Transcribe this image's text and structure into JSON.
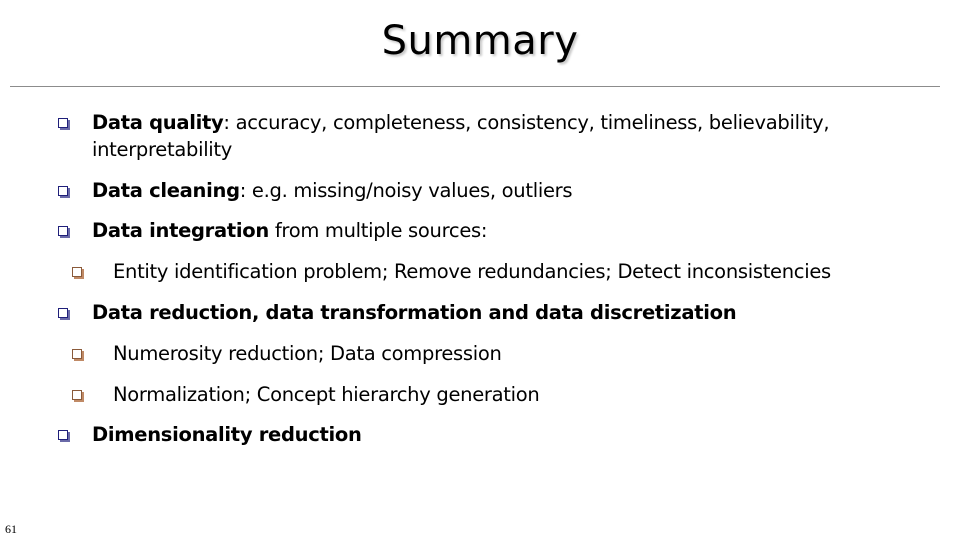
{
  "slide": {
    "title": "Summary",
    "page_number": "61",
    "bullets": [
      {
        "level": 1,
        "bold": "Data quality",
        "text": ": accuracy, completeness, consistency, timeliness, believability,",
        "text2": "interpretability"
      },
      {
        "level": 1,
        "bold": "Data cleaning",
        "text": ": e.g. missing/noisy values, outliers"
      },
      {
        "level": 1,
        "bold": "Data integration",
        "text": " from multiple sources:"
      },
      {
        "level": 2,
        "bold": "",
        "text": "Entity identification problem; Remove redundancies; Detect inconsistencies"
      },
      {
        "level": 1,
        "bold": "Data reduction, data transformation and data discretization",
        "text": ""
      },
      {
        "level": 2,
        "bold": "",
        "text": "Numerosity reduction; Data compression"
      },
      {
        "level": 2,
        "bold": "",
        "text": "Normalization; Concept hierarchy generation"
      },
      {
        "level": 1,
        "bold": "Dimensionality reduction",
        "text": ""
      }
    ],
    "colors": {
      "bullet_level1": "#1f1f7a",
      "bullet_level2": "#8a5a3a",
      "rule": "#8c8c8c"
    }
  }
}
